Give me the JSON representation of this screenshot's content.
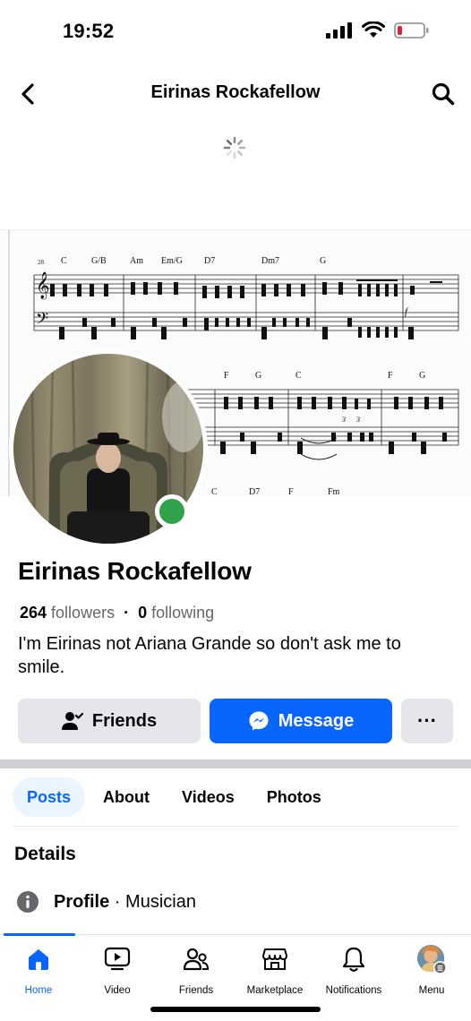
{
  "status_bar": {
    "time": "19:52"
  },
  "header": {
    "title": "Eirinas Rockafellow"
  },
  "cover": {
    "measure_number": "28",
    "chords_row1": [
      "C",
      "G/B",
      "Am",
      "Em/G",
      "D7",
      "Dm7",
      "G"
    ],
    "chords_row2": [
      "F",
      "G",
      "C",
      "F",
      "G"
    ],
    "chords_row3": [
      "C",
      "D7",
      "F",
      "Fm"
    ],
    "dynamic_mark": "f",
    "tuplet_mark": "3"
  },
  "profile": {
    "name": "Eirinas Rockafellow",
    "followers_count": "264",
    "followers_label": "followers",
    "separator": "·",
    "following_count": "0",
    "following_label": "following",
    "bio": "I'm Eirinas not Ariana Grande so don't ask me to smile.",
    "online": true
  },
  "actions": {
    "friends_label": "Friends",
    "message_label": "Message",
    "more_label": "···"
  },
  "tabs": [
    {
      "label": "Posts",
      "active": true
    },
    {
      "label": "About",
      "active": false
    },
    {
      "label": "Videos",
      "active": false
    },
    {
      "label": "Photos",
      "active": false
    }
  ],
  "details": {
    "title": "Details",
    "profile_type_label": "Profile",
    "profile_type_sep": " · ",
    "profile_type_value": "Musician"
  },
  "bottom_nav": [
    {
      "label": "Home",
      "icon": "home-icon",
      "active": true
    },
    {
      "label": "Video",
      "icon": "video-icon",
      "active": false
    },
    {
      "label": "Friends",
      "icon": "friends-icon",
      "active": false
    },
    {
      "label": "Marketplace",
      "icon": "marketplace-icon",
      "active": false
    },
    {
      "label": "Notifications",
      "icon": "bell-icon",
      "active": false
    },
    {
      "label": "Menu",
      "icon": "menu-avatar-icon",
      "active": false
    }
  ],
  "colors": {
    "accent": "#0866ff",
    "online": "#31a24c",
    "battery_low": "#e41e3f"
  }
}
